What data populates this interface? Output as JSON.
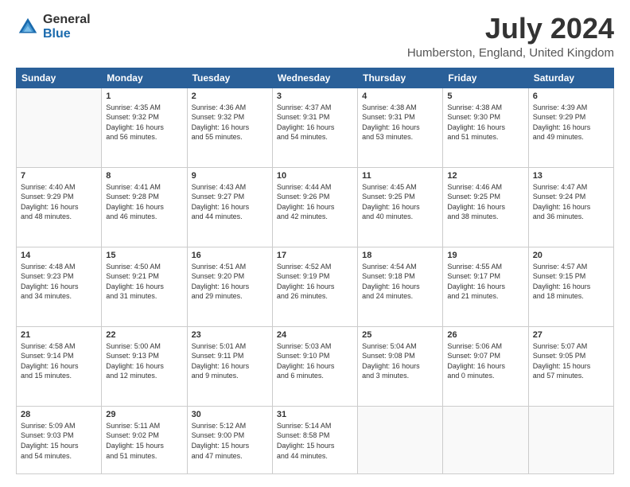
{
  "header": {
    "logo": {
      "general": "General",
      "blue": "Blue"
    },
    "title": "July 2024",
    "subtitle": "Humberston, England, United Kingdom"
  },
  "calendar": {
    "days_of_week": [
      "Sunday",
      "Monday",
      "Tuesday",
      "Wednesday",
      "Thursday",
      "Friday",
      "Saturday"
    ],
    "weeks": [
      [
        {
          "day": "",
          "info": ""
        },
        {
          "day": "1",
          "info": "Sunrise: 4:35 AM\nSunset: 9:32 PM\nDaylight: 16 hours\nand 56 minutes."
        },
        {
          "day": "2",
          "info": "Sunrise: 4:36 AM\nSunset: 9:32 PM\nDaylight: 16 hours\nand 55 minutes."
        },
        {
          "day": "3",
          "info": "Sunrise: 4:37 AM\nSunset: 9:31 PM\nDaylight: 16 hours\nand 54 minutes."
        },
        {
          "day": "4",
          "info": "Sunrise: 4:38 AM\nSunset: 9:31 PM\nDaylight: 16 hours\nand 53 minutes."
        },
        {
          "day": "5",
          "info": "Sunrise: 4:38 AM\nSunset: 9:30 PM\nDaylight: 16 hours\nand 51 minutes."
        },
        {
          "day": "6",
          "info": "Sunrise: 4:39 AM\nSunset: 9:29 PM\nDaylight: 16 hours\nand 49 minutes."
        }
      ],
      [
        {
          "day": "7",
          "info": "Sunrise: 4:40 AM\nSunset: 9:29 PM\nDaylight: 16 hours\nand 48 minutes."
        },
        {
          "day": "8",
          "info": "Sunrise: 4:41 AM\nSunset: 9:28 PM\nDaylight: 16 hours\nand 46 minutes."
        },
        {
          "day": "9",
          "info": "Sunrise: 4:43 AM\nSunset: 9:27 PM\nDaylight: 16 hours\nand 44 minutes."
        },
        {
          "day": "10",
          "info": "Sunrise: 4:44 AM\nSunset: 9:26 PM\nDaylight: 16 hours\nand 42 minutes."
        },
        {
          "day": "11",
          "info": "Sunrise: 4:45 AM\nSunset: 9:25 PM\nDaylight: 16 hours\nand 40 minutes."
        },
        {
          "day": "12",
          "info": "Sunrise: 4:46 AM\nSunset: 9:25 PM\nDaylight: 16 hours\nand 38 minutes."
        },
        {
          "day": "13",
          "info": "Sunrise: 4:47 AM\nSunset: 9:24 PM\nDaylight: 16 hours\nand 36 minutes."
        }
      ],
      [
        {
          "day": "14",
          "info": "Sunrise: 4:48 AM\nSunset: 9:23 PM\nDaylight: 16 hours\nand 34 minutes."
        },
        {
          "day": "15",
          "info": "Sunrise: 4:50 AM\nSunset: 9:21 PM\nDaylight: 16 hours\nand 31 minutes."
        },
        {
          "day": "16",
          "info": "Sunrise: 4:51 AM\nSunset: 9:20 PM\nDaylight: 16 hours\nand 29 minutes."
        },
        {
          "day": "17",
          "info": "Sunrise: 4:52 AM\nSunset: 9:19 PM\nDaylight: 16 hours\nand 26 minutes."
        },
        {
          "day": "18",
          "info": "Sunrise: 4:54 AM\nSunset: 9:18 PM\nDaylight: 16 hours\nand 24 minutes."
        },
        {
          "day": "19",
          "info": "Sunrise: 4:55 AM\nSunset: 9:17 PM\nDaylight: 16 hours\nand 21 minutes."
        },
        {
          "day": "20",
          "info": "Sunrise: 4:57 AM\nSunset: 9:15 PM\nDaylight: 16 hours\nand 18 minutes."
        }
      ],
      [
        {
          "day": "21",
          "info": "Sunrise: 4:58 AM\nSunset: 9:14 PM\nDaylight: 16 hours\nand 15 minutes."
        },
        {
          "day": "22",
          "info": "Sunrise: 5:00 AM\nSunset: 9:13 PM\nDaylight: 16 hours\nand 12 minutes."
        },
        {
          "day": "23",
          "info": "Sunrise: 5:01 AM\nSunset: 9:11 PM\nDaylight: 16 hours\nand 9 minutes."
        },
        {
          "day": "24",
          "info": "Sunrise: 5:03 AM\nSunset: 9:10 PM\nDaylight: 16 hours\nand 6 minutes."
        },
        {
          "day": "25",
          "info": "Sunrise: 5:04 AM\nSunset: 9:08 PM\nDaylight: 16 hours\nand 3 minutes."
        },
        {
          "day": "26",
          "info": "Sunrise: 5:06 AM\nSunset: 9:07 PM\nDaylight: 16 hours\nand 0 minutes."
        },
        {
          "day": "27",
          "info": "Sunrise: 5:07 AM\nSunset: 9:05 PM\nDaylight: 15 hours\nand 57 minutes."
        }
      ],
      [
        {
          "day": "28",
          "info": "Sunrise: 5:09 AM\nSunset: 9:03 PM\nDaylight: 15 hours\nand 54 minutes."
        },
        {
          "day": "29",
          "info": "Sunrise: 5:11 AM\nSunset: 9:02 PM\nDaylight: 15 hours\nand 51 minutes."
        },
        {
          "day": "30",
          "info": "Sunrise: 5:12 AM\nSunset: 9:00 PM\nDaylight: 15 hours\nand 47 minutes."
        },
        {
          "day": "31",
          "info": "Sunrise: 5:14 AM\nSunset: 8:58 PM\nDaylight: 15 hours\nand 44 minutes."
        },
        {
          "day": "",
          "info": ""
        },
        {
          "day": "",
          "info": ""
        },
        {
          "day": "",
          "info": ""
        }
      ]
    ]
  }
}
